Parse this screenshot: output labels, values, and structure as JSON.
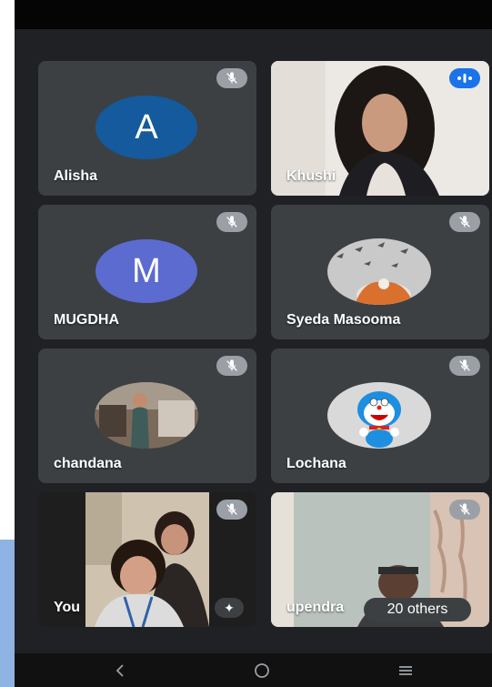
{
  "participants": [
    {
      "name": "Alisha",
      "initial": "A",
      "avatar_color": "#155a9c",
      "muted": true
    },
    {
      "name": "Khushi",
      "video": true,
      "speaking": true
    },
    {
      "name": "MUGDHA",
      "initial": "M",
      "avatar_color": "#5b6bd0",
      "muted": true
    },
    {
      "name": "Syeda Masooma",
      "photo_avatar": true,
      "muted": true
    },
    {
      "name": "chandana",
      "photo_avatar": true,
      "muted": true
    },
    {
      "name": "Lochana",
      "photo_avatar": true,
      "muted": true
    },
    {
      "name": "You",
      "video": true,
      "muted": true,
      "effects_icon": "sparkle-effects-icon"
    },
    {
      "name": "upendra",
      "video": true,
      "muted": true
    }
  ],
  "others_chip": {
    "label": "20 others"
  },
  "icons": {
    "mute": "mic-off-icon",
    "speaking": "audio-wave-icon",
    "nav_back": "back-chevron-icon",
    "nav_home": "home-circle-icon",
    "nav_recents": "recents-menu-icon"
  }
}
